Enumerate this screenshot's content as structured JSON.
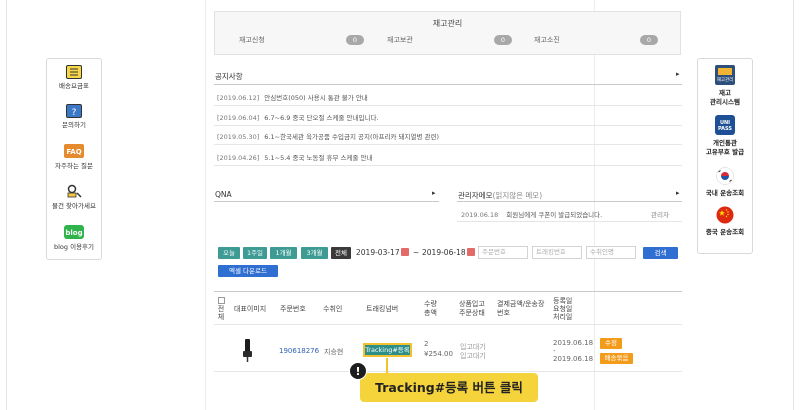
{
  "stock": {
    "title": "재고관리",
    "items": [
      {
        "label": "재고신청",
        "count": "0"
      },
      {
        "label": "재고보관",
        "count": "0"
      },
      {
        "label": "재고소진",
        "count": "0"
      }
    ]
  },
  "left_menu": [
    {
      "label": "배송요금표",
      "icon": "fee-list-icon"
    },
    {
      "label": "문의하기",
      "icon": "inquiry-icon"
    },
    {
      "label": "자주하는 질문",
      "icon": "faq-icon"
    },
    {
      "label": "물건 찾아가세요",
      "icon": "find-item-icon"
    },
    {
      "label": "blog 이용후기",
      "icon": "blog-icon"
    }
  ],
  "right_menu": [
    {
      "label_line1": "재고",
      "label_line2": "관리시스템",
      "icon_text": "재고관리",
      "icon": "stock-system-icon"
    },
    {
      "label_line1": "개인통관",
      "label_line2": "고유부호 발급",
      "icon_text": "UNI PASS",
      "icon": "unipass-icon"
    },
    {
      "label_line1": "국내 운송조회",
      "label_line2": "",
      "icon": "korea-flag-icon"
    },
    {
      "label_line1": "중국 운송조회",
      "label_line2": "",
      "icon": "china-flag-icon"
    }
  ],
  "notice": {
    "title": "공지사항",
    "arrow": "▸",
    "items": [
      {
        "date": "[2019.06.12]",
        "text": "안심번호(050) 사용시 통관 불가 안내"
      },
      {
        "date": "[2019.06.04]",
        "text": "6.7~6.9 중국 단오절 스케줄 안내입니다."
      },
      {
        "date": "[2019.05.30]",
        "text": "6.1~한국세관 육가공품 수입금지 공지(아프리카 돼지열병 관련)"
      },
      {
        "date": "[2019.04.26]",
        "text": "5.1~5.4 중국 노동절 휴무 스케줄 안내"
      }
    ]
  },
  "qna": {
    "title": "QNA",
    "arrow": "▸"
  },
  "memo": {
    "title": "관리자메모",
    "subtitle": "(읽지않은 메모)",
    "arrow": "▸",
    "row": {
      "date": "2019.06.18",
      "text": "회원님에게 쿠폰이 발급되었습니다.",
      "author": "관리자"
    }
  },
  "filter": {
    "buttons": [
      "오늘",
      "1주일",
      "1개월",
      "3개월",
      "전체"
    ],
    "date_from": "2019-03-17",
    "date_sep": "~",
    "date_to": "2019-06-18",
    "ph_order": "주문번호",
    "ph_tracking": "트래킹번호",
    "ph_recipient": "수취인명",
    "search_label": "검색",
    "excel_label": "엑셀 다운로드"
  },
  "table": {
    "headers": {
      "all": "전체",
      "image": "대표이미지",
      "order_no": "주문번호",
      "recipient": "수취인",
      "tracking": "트래킹넘버",
      "qty_1": "수량",
      "qty_2": "총액",
      "status_1": "상품입고",
      "status_2": "주문상태",
      "pay_1": "결제금액/운송장",
      "pay_2": "번호",
      "reg_1": "등록일",
      "reg_2": "요청일",
      "reg_3": "처리일"
    },
    "row": {
      "order_no": "190618276",
      "recipient": "지승현",
      "tracking_btn": "Tracking#등록",
      "qty": "2",
      "amount": "¥254.00",
      "status_1": "입고대기",
      "status_2": "입고대기",
      "date_1": "2019.06.18",
      "date_2": "2019.06.18",
      "date_dash": "-",
      "edit_label": "수정",
      "ship_label": "배송묶음"
    }
  },
  "callout": {
    "icon_text": "!",
    "text": "Tracking#등록 버튼 클릭"
  },
  "colors": {
    "green": "#3d9b94",
    "blue": "#2f6fd1",
    "orange": "#f39b1b",
    "highlight": "#f5d33b"
  }
}
